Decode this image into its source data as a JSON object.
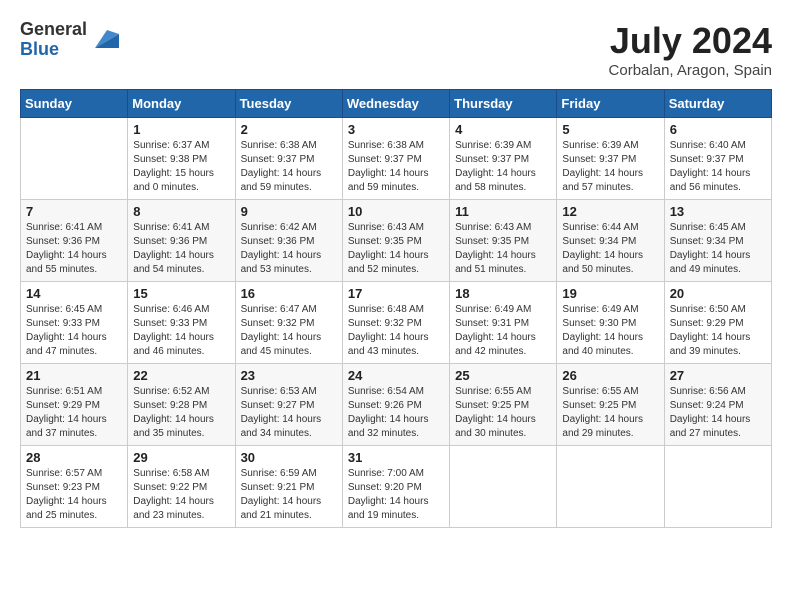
{
  "logo": {
    "general": "General",
    "blue": "Blue"
  },
  "title": {
    "month_year": "July 2024",
    "location": "Corbalan, Aragon, Spain"
  },
  "weekdays": [
    "Sunday",
    "Monday",
    "Tuesday",
    "Wednesday",
    "Thursday",
    "Friday",
    "Saturday"
  ],
  "weeks": [
    [
      {
        "day": "",
        "content": ""
      },
      {
        "day": "1",
        "content": "Sunrise: 6:37 AM\nSunset: 9:38 PM\nDaylight: 15 hours\nand 0 minutes."
      },
      {
        "day": "2",
        "content": "Sunrise: 6:38 AM\nSunset: 9:37 PM\nDaylight: 14 hours\nand 59 minutes."
      },
      {
        "day": "3",
        "content": "Sunrise: 6:38 AM\nSunset: 9:37 PM\nDaylight: 14 hours\nand 59 minutes."
      },
      {
        "day": "4",
        "content": "Sunrise: 6:39 AM\nSunset: 9:37 PM\nDaylight: 14 hours\nand 58 minutes."
      },
      {
        "day": "5",
        "content": "Sunrise: 6:39 AM\nSunset: 9:37 PM\nDaylight: 14 hours\nand 57 minutes."
      },
      {
        "day": "6",
        "content": "Sunrise: 6:40 AM\nSunset: 9:37 PM\nDaylight: 14 hours\nand 56 minutes."
      }
    ],
    [
      {
        "day": "7",
        "content": "Sunrise: 6:41 AM\nSunset: 9:36 PM\nDaylight: 14 hours\nand 55 minutes."
      },
      {
        "day": "8",
        "content": "Sunrise: 6:41 AM\nSunset: 9:36 PM\nDaylight: 14 hours\nand 54 minutes."
      },
      {
        "day": "9",
        "content": "Sunrise: 6:42 AM\nSunset: 9:36 PM\nDaylight: 14 hours\nand 53 minutes."
      },
      {
        "day": "10",
        "content": "Sunrise: 6:43 AM\nSunset: 9:35 PM\nDaylight: 14 hours\nand 52 minutes."
      },
      {
        "day": "11",
        "content": "Sunrise: 6:43 AM\nSunset: 9:35 PM\nDaylight: 14 hours\nand 51 minutes."
      },
      {
        "day": "12",
        "content": "Sunrise: 6:44 AM\nSunset: 9:34 PM\nDaylight: 14 hours\nand 50 minutes."
      },
      {
        "day": "13",
        "content": "Sunrise: 6:45 AM\nSunset: 9:34 PM\nDaylight: 14 hours\nand 49 minutes."
      }
    ],
    [
      {
        "day": "14",
        "content": "Sunrise: 6:45 AM\nSunset: 9:33 PM\nDaylight: 14 hours\nand 47 minutes."
      },
      {
        "day": "15",
        "content": "Sunrise: 6:46 AM\nSunset: 9:33 PM\nDaylight: 14 hours\nand 46 minutes."
      },
      {
        "day": "16",
        "content": "Sunrise: 6:47 AM\nSunset: 9:32 PM\nDaylight: 14 hours\nand 45 minutes."
      },
      {
        "day": "17",
        "content": "Sunrise: 6:48 AM\nSunset: 9:32 PM\nDaylight: 14 hours\nand 43 minutes."
      },
      {
        "day": "18",
        "content": "Sunrise: 6:49 AM\nSunset: 9:31 PM\nDaylight: 14 hours\nand 42 minutes."
      },
      {
        "day": "19",
        "content": "Sunrise: 6:49 AM\nSunset: 9:30 PM\nDaylight: 14 hours\nand 40 minutes."
      },
      {
        "day": "20",
        "content": "Sunrise: 6:50 AM\nSunset: 9:29 PM\nDaylight: 14 hours\nand 39 minutes."
      }
    ],
    [
      {
        "day": "21",
        "content": "Sunrise: 6:51 AM\nSunset: 9:29 PM\nDaylight: 14 hours\nand 37 minutes."
      },
      {
        "day": "22",
        "content": "Sunrise: 6:52 AM\nSunset: 9:28 PM\nDaylight: 14 hours\nand 35 minutes."
      },
      {
        "day": "23",
        "content": "Sunrise: 6:53 AM\nSunset: 9:27 PM\nDaylight: 14 hours\nand 34 minutes."
      },
      {
        "day": "24",
        "content": "Sunrise: 6:54 AM\nSunset: 9:26 PM\nDaylight: 14 hours\nand 32 minutes."
      },
      {
        "day": "25",
        "content": "Sunrise: 6:55 AM\nSunset: 9:25 PM\nDaylight: 14 hours\nand 30 minutes."
      },
      {
        "day": "26",
        "content": "Sunrise: 6:55 AM\nSunset: 9:25 PM\nDaylight: 14 hours\nand 29 minutes."
      },
      {
        "day": "27",
        "content": "Sunrise: 6:56 AM\nSunset: 9:24 PM\nDaylight: 14 hours\nand 27 minutes."
      }
    ],
    [
      {
        "day": "28",
        "content": "Sunrise: 6:57 AM\nSunset: 9:23 PM\nDaylight: 14 hours\nand 25 minutes."
      },
      {
        "day": "29",
        "content": "Sunrise: 6:58 AM\nSunset: 9:22 PM\nDaylight: 14 hours\nand 23 minutes."
      },
      {
        "day": "30",
        "content": "Sunrise: 6:59 AM\nSunset: 9:21 PM\nDaylight: 14 hours\nand 21 minutes."
      },
      {
        "day": "31",
        "content": "Sunrise: 7:00 AM\nSunset: 9:20 PM\nDaylight: 14 hours\nand 19 minutes."
      },
      {
        "day": "",
        "content": ""
      },
      {
        "day": "",
        "content": ""
      },
      {
        "day": "",
        "content": ""
      }
    ]
  ]
}
